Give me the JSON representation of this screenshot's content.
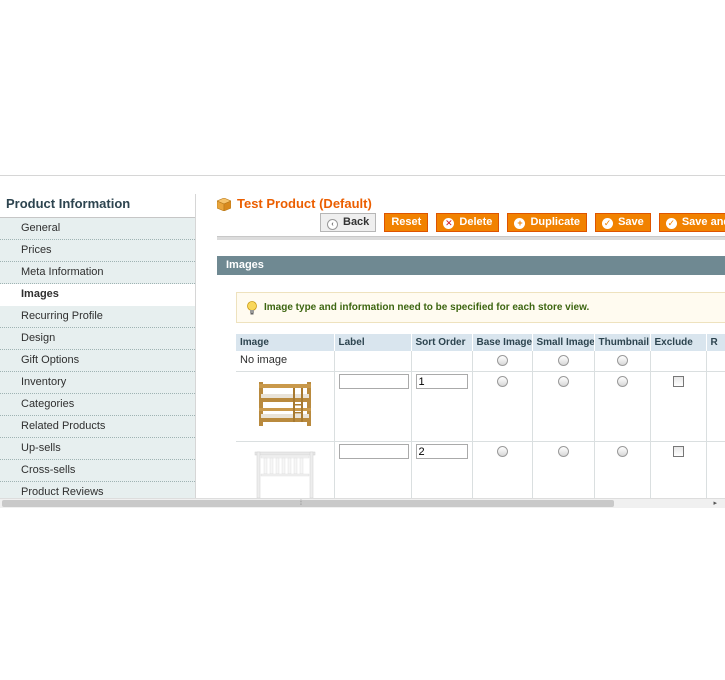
{
  "sidebar": {
    "title": "Product Information",
    "items": [
      {
        "label": "General",
        "active": false
      },
      {
        "label": "Prices",
        "active": false
      },
      {
        "label": "Meta Information",
        "active": false
      },
      {
        "label": "Images",
        "active": true
      },
      {
        "label": "Recurring Profile",
        "active": false
      },
      {
        "label": "Design",
        "active": false
      },
      {
        "label": "Gift Options",
        "active": false
      },
      {
        "label": "Inventory",
        "active": false
      },
      {
        "label": "Categories",
        "active": false
      },
      {
        "label": "Related Products",
        "active": false
      },
      {
        "label": "Up-sells",
        "active": false
      },
      {
        "label": "Cross-sells",
        "active": false
      },
      {
        "label": "Product Reviews",
        "active": false
      }
    ]
  },
  "header": {
    "title": "Test Product (Default)",
    "icon": "product-cube-icon"
  },
  "buttons": {
    "back": "Back",
    "reset": "Reset",
    "delete": "Delete",
    "duplicate": "Duplicate",
    "save": "Save",
    "save_continue": "Save and C"
  },
  "section": {
    "title": "Images",
    "notice": "Image type and information need to be specified for each store view."
  },
  "grid": {
    "columns": [
      "Image",
      "Label",
      "Sort Order",
      "Base Image",
      "Small Image",
      "Thumbnail",
      "Exclude",
      "R"
    ],
    "no_image_label": "No image",
    "rows": [
      {
        "image": "bunk-bed",
        "label": "",
        "sort_order": "1"
      },
      {
        "image": "headboard",
        "label": "",
        "sort_order": "2"
      }
    ]
  },
  "colors": {
    "accent": "#f18200",
    "title": "#eb5e00",
    "section_bar": "#6f8992",
    "notice_text": "#3d6611"
  }
}
